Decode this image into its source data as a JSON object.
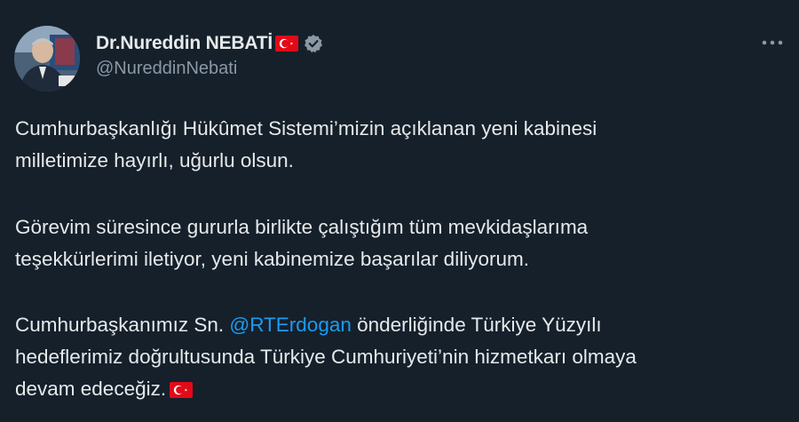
{
  "author": {
    "display_name": "Dr.Nureddin NEBATİ",
    "handle": "@NureddinNebati",
    "flag_icon": "turkey-flag-icon",
    "verified_icon": "verified-badge-icon",
    "verified_color": "#8b98a5"
  },
  "menu": {
    "icon": "more-horizontal-icon"
  },
  "tweet": {
    "paragraph_1": {
      "line_1": "Cumhurbaşkanlığı Hükûmet Sistemi’mizin açıklanan yeni kabinesi",
      "line_2": "milletimize hayırlı, uğurlu olsun."
    },
    "paragraph_2": {
      "line_1": "Görevim süresince gururla birlikte çalıştığım tüm mevkidaşlarıma",
      "line_2": "teşekkürlerimi iletiyor, yeni kabinemize başarılar diliyorum."
    },
    "paragraph_3": {
      "line_1_before": "Cumhurbaşkanımız Sn. ",
      "mention": "@RTErdogan",
      "line_1_after": " önderliğinde Türkiye Yüzyılı",
      "line_2": "hedeflerimiz doğrultusunda Türkiye Cumhuriyeti’nin hizmetkarı olmaya",
      "line_3": "devam edeceğiz."
    }
  },
  "colors": {
    "background": "#15202b",
    "text": "#e7e9ea",
    "secondary_text": "#8b98a5",
    "link": "#1d9bf0",
    "flag_red": "#e30a17"
  }
}
